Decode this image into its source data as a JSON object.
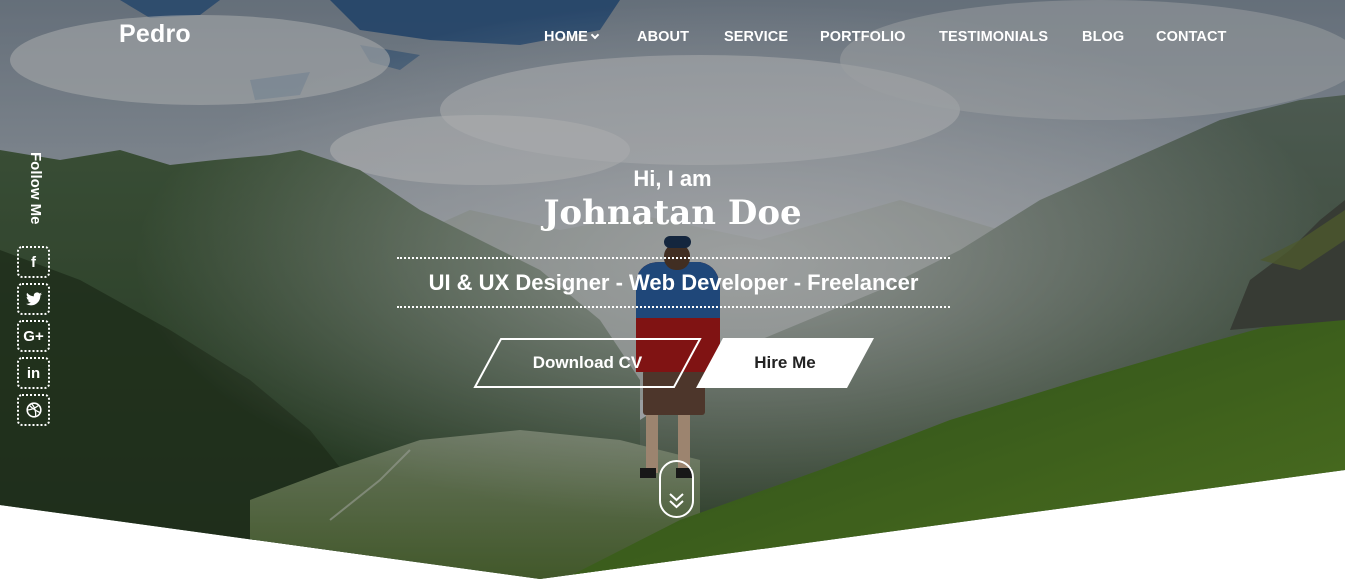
{
  "brand": {
    "logo": "Pedro"
  },
  "nav": {
    "items": [
      {
        "label": "HOME"
      },
      {
        "label": "ABOUT"
      },
      {
        "label": "SERVICE"
      },
      {
        "label": "PORTFOLIO"
      },
      {
        "label": "TESTIMONIALS"
      },
      {
        "label": "BLOG"
      },
      {
        "label": "CONTACT"
      }
    ]
  },
  "follow": {
    "label": "Follow Me",
    "icons": [
      "facebook-icon",
      "twitter-icon",
      "google-plus-icon",
      "linkedin-icon",
      "dribbble-icon"
    ],
    "glyphs": {
      "facebook": "f",
      "googleplus": "G+",
      "linkedin": "in"
    }
  },
  "intro": {
    "greeting": "Hi, I am",
    "name": "Johnatan Doe",
    "roles": "UI & UX Designer - Web Developer - Freelancer"
  },
  "buttons": {
    "download": "Download CV",
    "hire": "Hire Me"
  },
  "colors": {
    "sky": "#9aa6b4",
    "grass": "#4e7d2e",
    "jacket_red": "#b21b1b",
    "jacket_blue": "#2b63a8",
    "hire_button_bg": "#ffffff"
  }
}
